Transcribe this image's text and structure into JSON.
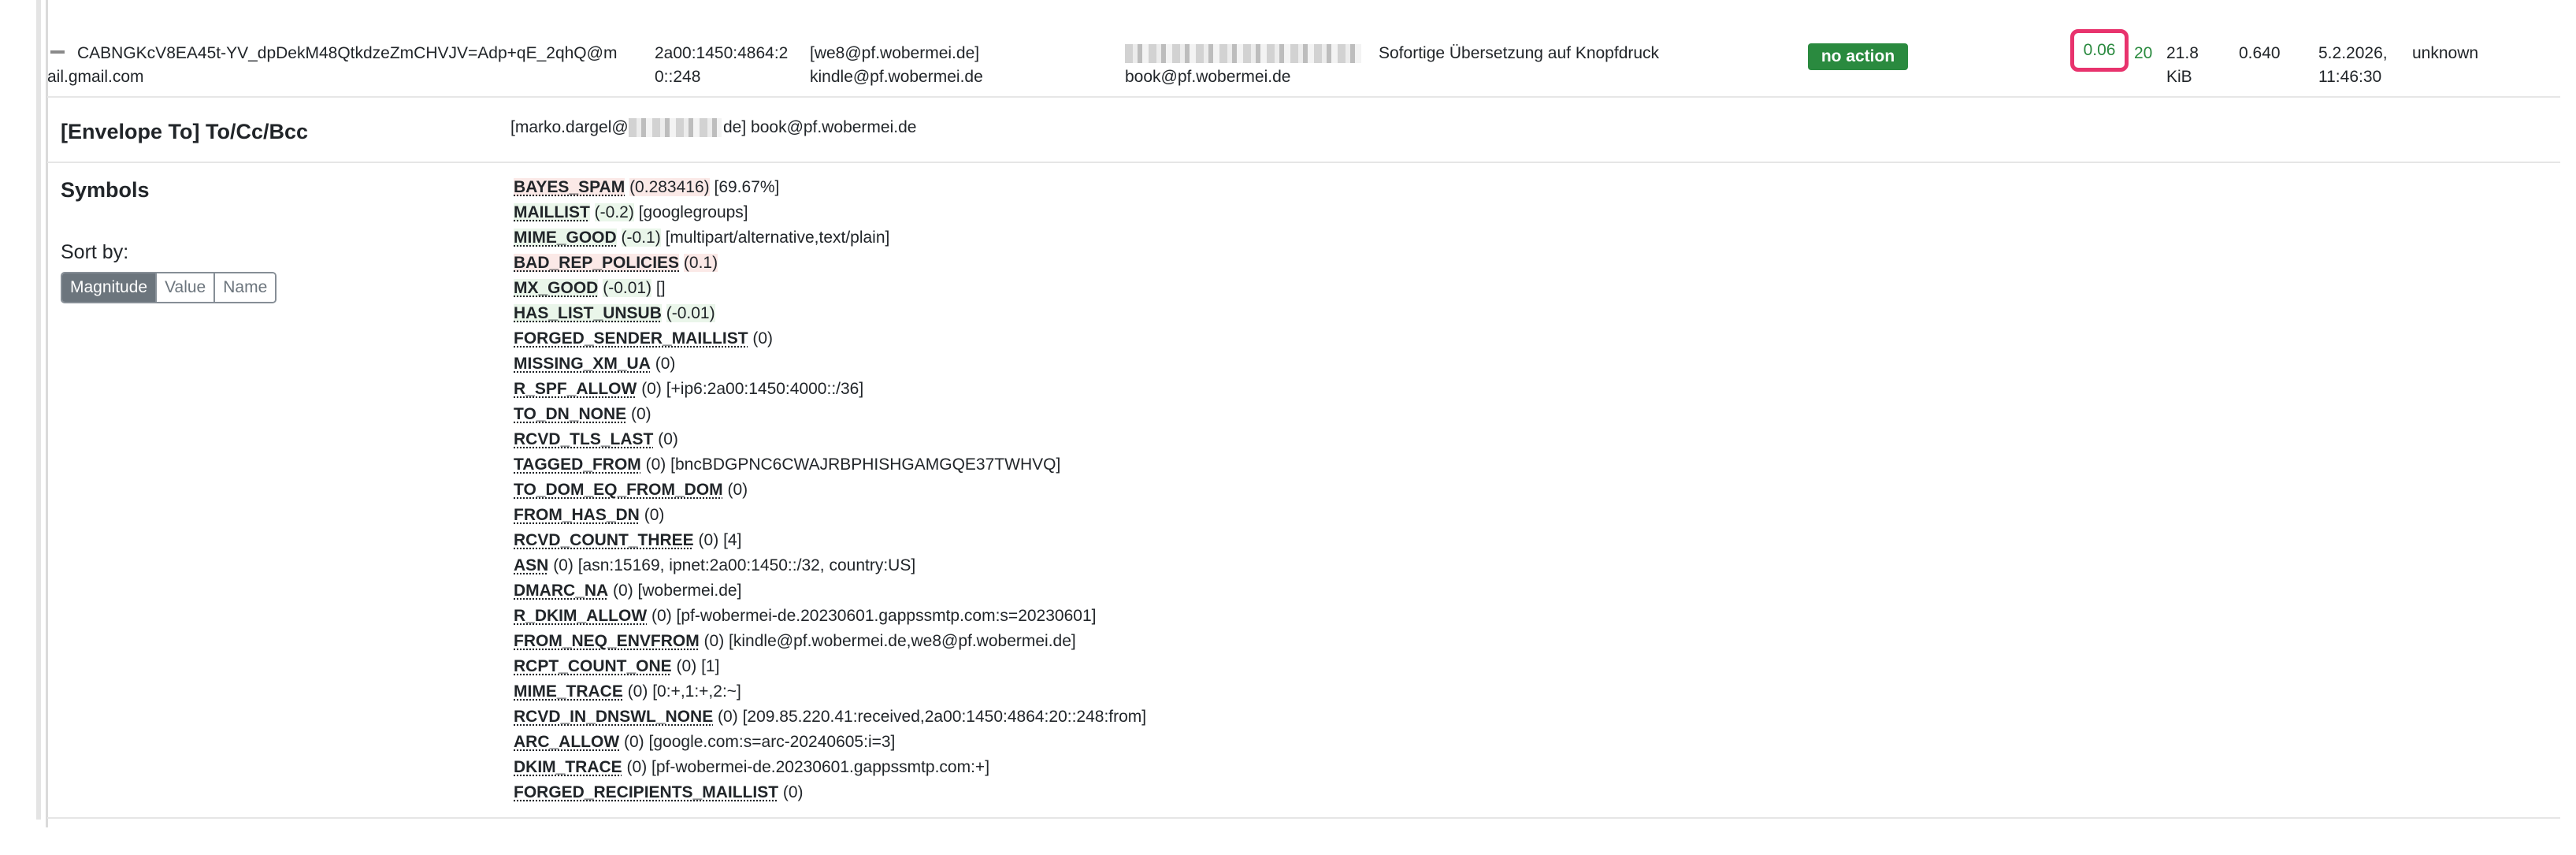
{
  "message": {
    "id_line1": "CABNGKcV8EA45t-YV_dpDekM48QtkdzeZmCHVJV=Adp+qE_2qhQ@m",
    "id_line2": "ail.gmail.com",
    "ip_line1": "2a00:1450:4864:2",
    "ip_line2": "0::248",
    "env_rcpt_line1": "[we8@pf.wobermei.de]",
    "env_rcpt_line2": "kindle@pf.wobermei.de",
    "from_line2": "book@pf.wobermei.de",
    "subject": "Sofortige Übersetzung auf Knopfdruck",
    "action": "no action",
    "score": "0.06",
    "required": "20",
    "size_line1": "21.8",
    "size_line2": "KiB",
    "scan_time": "0.640",
    "date_line1": "5.2.2026,",
    "date_line2": "11:46:30",
    "user": "unknown"
  },
  "envelope": {
    "title": "[Envelope To] To/Cc/Bcc",
    "value_prefix": "[marko.dargel@",
    "value_suffix": "de] book@pf.wobermei.de"
  },
  "symbols_section": {
    "title": "Symbols",
    "sort_label": "Sort by:",
    "sort_buttons": [
      "Magnitude",
      "Value",
      "Name"
    ]
  },
  "symbols": [
    {
      "name": "BAYES_SPAM",
      "score": "(0.283416)",
      "options": "[69.67%]",
      "kind": "spam"
    },
    {
      "name": "MAILLIST",
      "score": "(-0.2)",
      "options": "[googlegroups]",
      "kind": "ham"
    },
    {
      "name": "MIME_GOOD",
      "score": "(-0.1)",
      "options": "[multipart/alternative,text/plain]",
      "kind": "ham"
    },
    {
      "name": "BAD_REP_POLICIES",
      "score": "(0.1)",
      "options": "",
      "kind": "spam"
    },
    {
      "name": "MX_GOOD",
      "score": "(-0.01)",
      "options": "[]",
      "kind": "ham"
    },
    {
      "name": "HAS_LIST_UNSUB",
      "score": "(-0.01)",
      "options": "",
      "kind": "ham"
    },
    {
      "name": "FORGED_SENDER_MAILLIST",
      "score": "(0)",
      "options": "",
      "kind": ""
    },
    {
      "name": "MISSING_XM_UA",
      "score": "(0)",
      "options": "",
      "kind": ""
    },
    {
      "name": "R_SPF_ALLOW",
      "score": "(0)",
      "options": "[+ip6:2a00:1450:4000::/36]",
      "kind": ""
    },
    {
      "name": "TO_DN_NONE",
      "score": "(0)",
      "options": "",
      "kind": ""
    },
    {
      "name": "RCVD_TLS_LAST",
      "score": "(0)",
      "options": "",
      "kind": ""
    },
    {
      "name": "TAGGED_FROM",
      "score": "(0)",
      "options": "[bncBDGPNC6CWAJRBPHISHGAMGQE37TWHVQ]",
      "kind": ""
    },
    {
      "name": "TO_DOM_EQ_FROM_DOM",
      "score": "(0)",
      "options": "",
      "kind": ""
    },
    {
      "name": "FROM_HAS_DN",
      "score": "(0)",
      "options": "",
      "kind": ""
    },
    {
      "name": "RCVD_COUNT_THREE",
      "score": "(0)",
      "options": "[4]",
      "kind": ""
    },
    {
      "name": "ASN",
      "score": "(0)",
      "options": "[asn:15169, ipnet:2a00:1450::/32, country:US]",
      "kind": ""
    },
    {
      "name": "DMARC_NA",
      "score": "(0)",
      "options": "[wobermei.de]",
      "kind": ""
    },
    {
      "name": "R_DKIM_ALLOW",
      "score": "(0)",
      "options": "[pf-wobermei-de.20230601.gappssmtp.com:s=20230601]",
      "kind": ""
    },
    {
      "name": "FROM_NEQ_ENVFROM",
      "score": "(0)",
      "options": "[kindle@pf.wobermei.de,we8@pf.wobermei.de]",
      "kind": ""
    },
    {
      "name": "RCPT_COUNT_ONE",
      "score": "(0)",
      "options": "[1]",
      "kind": ""
    },
    {
      "name": "MIME_TRACE",
      "score": "(0)",
      "options": "[0:+,1:+,2:~]",
      "kind": ""
    },
    {
      "name": "RCVD_IN_DNSWL_NONE",
      "score": "(0)",
      "options": "[209.85.220.41:received,2a00:1450:4864:20::248:from]",
      "kind": ""
    },
    {
      "name": "ARC_ALLOW",
      "score": "(0)",
      "options": "[google.com:s=arc-20240605:i=3]",
      "kind": ""
    },
    {
      "name": "DKIM_TRACE",
      "score": "(0)",
      "options": "[pf-wobermei-de.20230601.gappssmtp.com:+]",
      "kind": ""
    },
    {
      "name": "FORGED_RECIPIENTS_MAILLIST",
      "score": "(0)",
      "options": "",
      "kind": ""
    }
  ]
}
